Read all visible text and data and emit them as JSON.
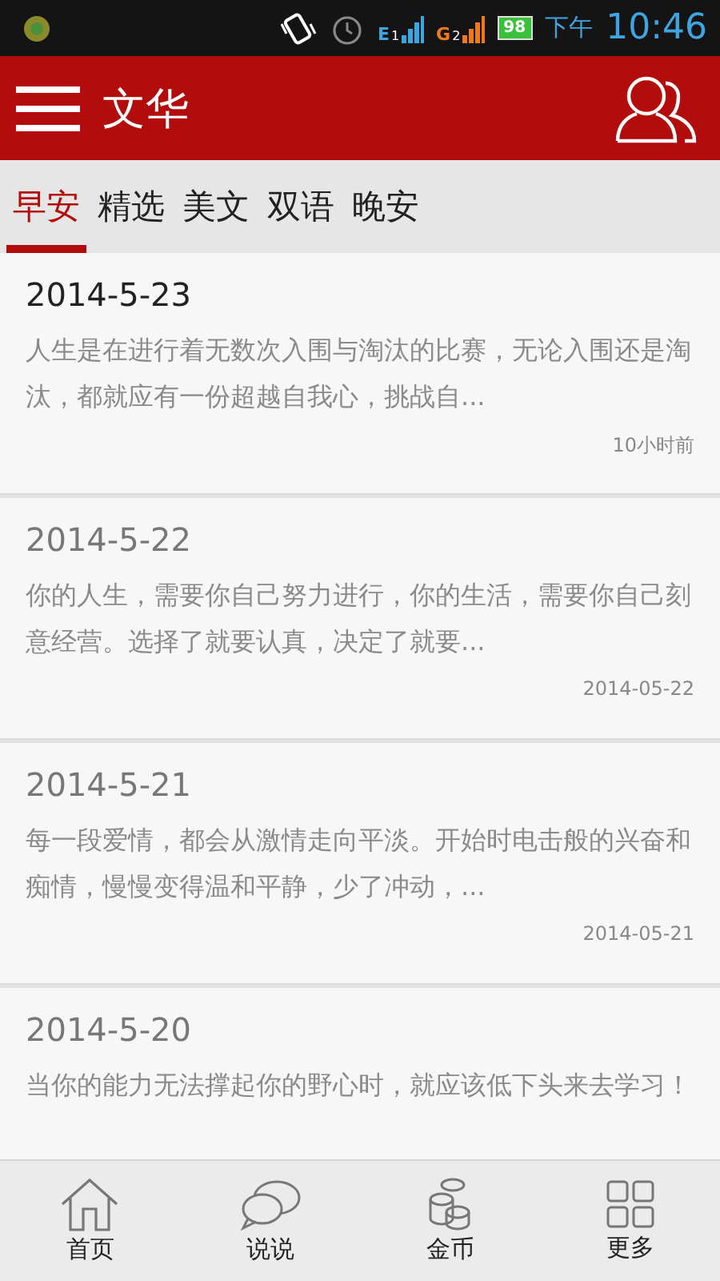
{
  "status_bar": {
    "sim1_network": "E",
    "sim1_slot": "1",
    "sim2_network": "G",
    "sim2_slot": "2",
    "battery": "98",
    "am_pm": "下午",
    "time": "10:46"
  },
  "header": {
    "title": "文华"
  },
  "tabs": [
    {
      "label": "早安",
      "selected": true
    },
    {
      "label": "精选",
      "selected": false
    },
    {
      "label": "美文",
      "selected": false
    },
    {
      "label": "双语",
      "selected": false
    },
    {
      "label": "晚安",
      "selected": false
    }
  ],
  "articles": [
    {
      "title": "2014-5-23",
      "excerpt": "人生是在进行着无数次入围与淘汰的比赛，无论入围还是淘汰，都就应有一份超越自我心，挑战自...",
      "time": "10小时前",
      "read": false
    },
    {
      "title": "2014-5-22",
      "excerpt": "你的人生，需要你自己努力进行，你的生活，需要你自己刻意经营。选择了就要认真，决定了就要...",
      "time": "2014-05-22",
      "read": true
    },
    {
      "title": "2014-5-21",
      "excerpt": "每一段爱情，都会从激情走向平淡。开始时电击般的兴奋和痴情，慢慢变得温和平静，少了冲动，...",
      "time": "2014-05-21",
      "read": true
    },
    {
      "title": "2014-5-20",
      "excerpt": "当你的能力无法撑起你的野心时，就应该低下头来去学习！",
      "read": true
    }
  ],
  "bottom_nav": [
    {
      "kind": "home",
      "label": "首页"
    },
    {
      "kind": "chat",
      "label": "说说"
    },
    {
      "kind": "coins",
      "label": "金币"
    },
    {
      "kind": "grid",
      "label": "更多"
    }
  ]
}
